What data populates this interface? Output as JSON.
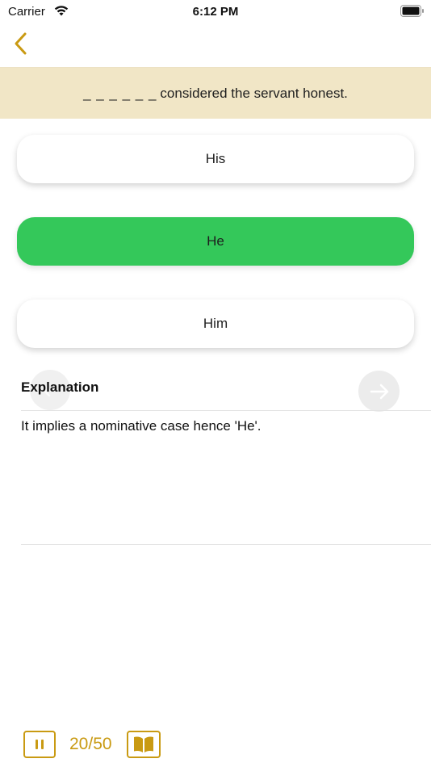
{
  "status": {
    "carrier": "Carrier",
    "time": "6:12 PM"
  },
  "nav": {
    "back_icon": "chevron-left-icon"
  },
  "question": {
    "blank": "_ _ _ _ _ _",
    "text": "considered the servant honest."
  },
  "options": [
    {
      "label": "His",
      "state": "normal"
    },
    {
      "label": "He",
      "state": "correct"
    },
    {
      "label": "Him",
      "state": "normal"
    }
  ],
  "explanation": {
    "title": "Explanation",
    "text": "It implies a nominative case hence 'He'."
  },
  "footer": {
    "counter": "20/50"
  },
  "colors": {
    "accent": "#c99a12",
    "correct": "#34c85a",
    "question_bg": "#f1e6c6"
  }
}
